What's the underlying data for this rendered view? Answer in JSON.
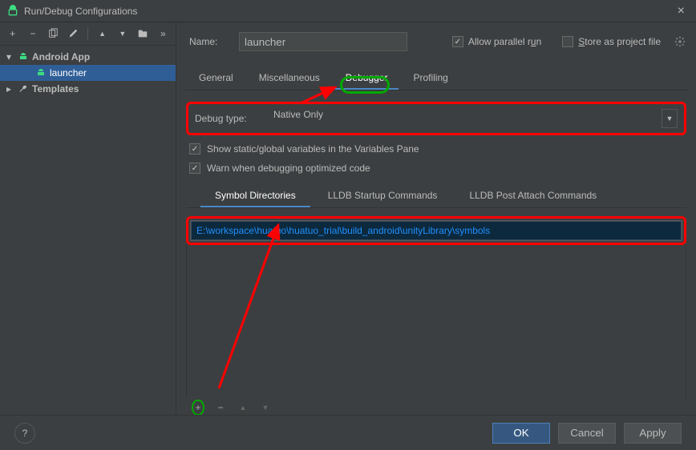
{
  "window": {
    "title": "Run/Debug Configurations"
  },
  "name_field": {
    "label": "Name:",
    "value": "launcher"
  },
  "options": {
    "allow_parallel": "Allow parallel run",
    "store_as_project": "Store as project file"
  },
  "tree": {
    "android_app": "Android App",
    "launcher": "launcher",
    "templates": "Templates"
  },
  "toolbar_icons": {
    "plus": "+",
    "minus": "−",
    "copy": "⿻",
    "wrench": "🔧",
    "up": "▲",
    "down": "▼",
    "folder": "📁",
    "more": "»"
  },
  "tabs": {
    "general": "General",
    "misc": "Miscellaneous",
    "debugger": "Debugger",
    "profiling": "Profiling"
  },
  "debug": {
    "label": "Debug type:",
    "value": "Native Only"
  },
  "checks": {
    "show_static": "Show static/global variables in the Variables Pane",
    "warn_optimized": "Warn when debugging optimized code"
  },
  "subtabs": {
    "symdirs": "Symbol Directories",
    "lldb_startup": "LLDB Startup Commands",
    "lldb_post": "LLDB Post Attach Commands"
  },
  "symbol_path": "E:\\workspace\\huatuo\\huatuo_trial\\build_android\\unityLibrary\\symbols",
  "list_btns": {
    "plus": "+",
    "minus": "−",
    "up": "▲",
    "down": "▼"
  },
  "buttons": {
    "ok": "OK",
    "cancel": "Cancel",
    "apply": "Apply",
    "help": "?"
  }
}
